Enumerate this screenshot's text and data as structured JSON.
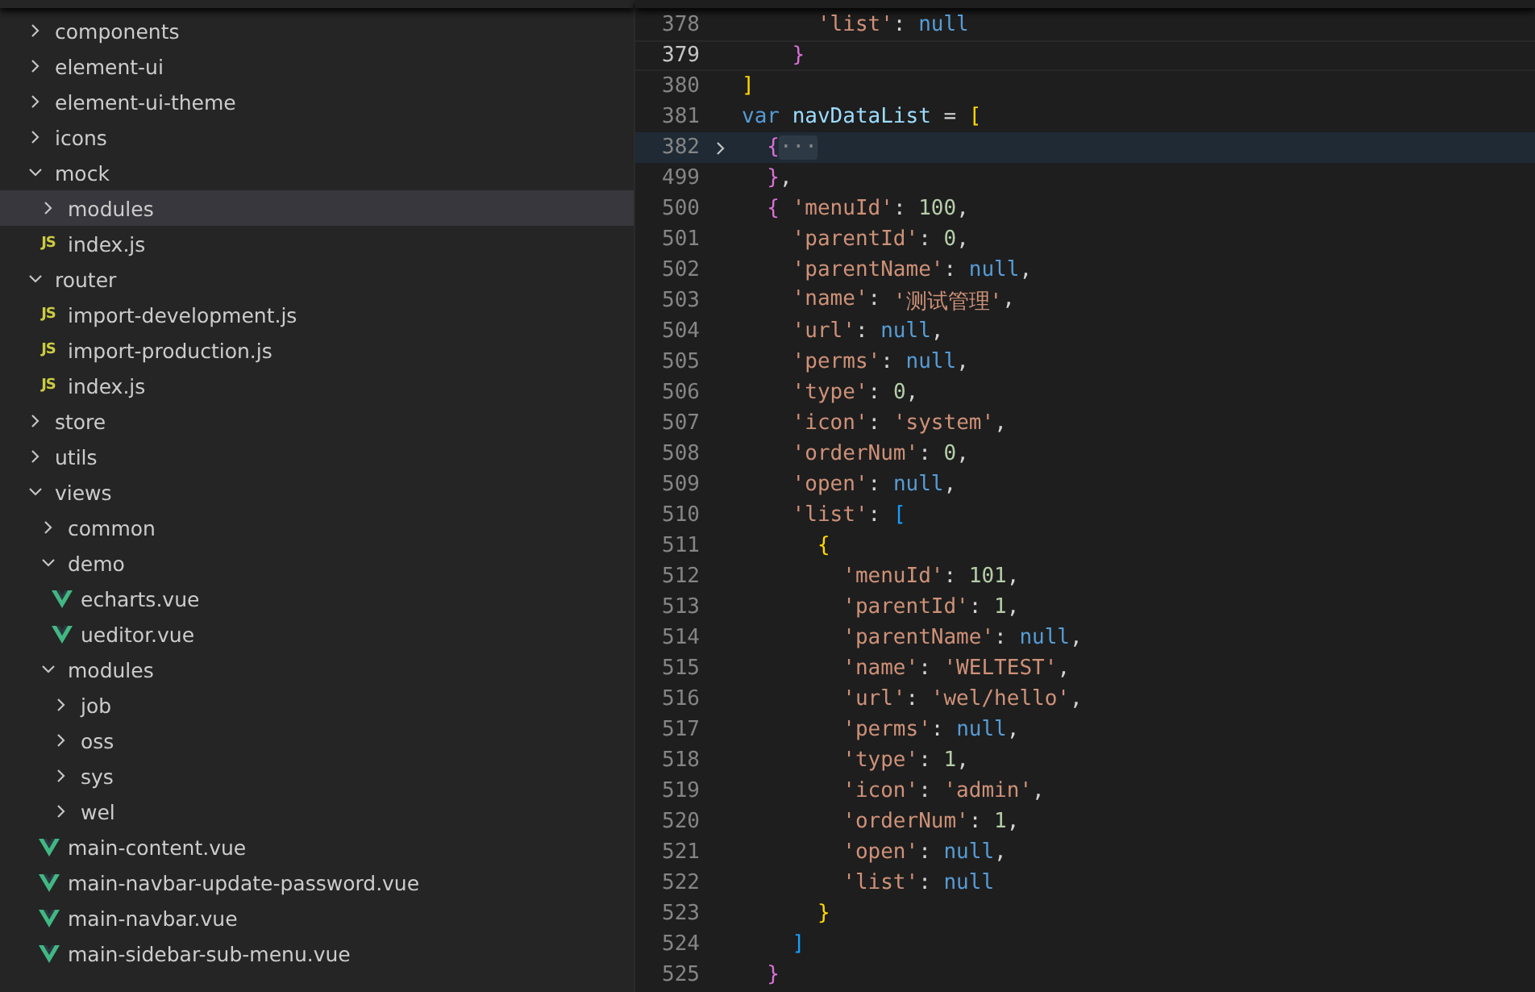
{
  "explorer": {
    "items": [
      {
        "label": "components",
        "kind": "folder",
        "expanded": false,
        "selected": false
      },
      {
        "label": "element-ui",
        "kind": "folder",
        "expanded": false,
        "selected": false
      },
      {
        "label": "element-ui-theme",
        "kind": "folder",
        "expanded": false,
        "selected": false
      },
      {
        "label": "icons",
        "kind": "folder",
        "expanded": false,
        "selected": false
      },
      {
        "label": "mock",
        "kind": "folder",
        "expanded": true,
        "selected": false,
        "children": [
          {
            "label": "modules",
            "kind": "folder",
            "expanded": false,
            "selected": true
          },
          {
            "label": "index.js",
            "kind": "js",
            "icon_text": "JS",
            "selected": false
          }
        ]
      },
      {
        "label": "router",
        "kind": "folder",
        "expanded": true,
        "selected": false,
        "children": [
          {
            "label": "import-development.js",
            "kind": "js",
            "icon_text": "JS",
            "selected": false
          },
          {
            "label": "import-production.js",
            "kind": "js",
            "icon_text": "JS",
            "selected": false
          },
          {
            "label": "index.js",
            "kind": "js",
            "icon_text": "JS",
            "selected": false
          }
        ]
      },
      {
        "label": "store",
        "kind": "folder",
        "expanded": false,
        "selected": false
      },
      {
        "label": "utils",
        "kind": "folder",
        "expanded": false,
        "selected": false
      },
      {
        "label": "views",
        "kind": "folder",
        "expanded": true,
        "selected": false,
        "children": [
          {
            "label": "common",
            "kind": "folder",
            "expanded": false,
            "selected": false
          },
          {
            "label": "demo",
            "kind": "folder",
            "expanded": true,
            "selected": false,
            "children": [
              {
                "label": "echarts.vue",
                "kind": "vue",
                "selected": false
              },
              {
                "label": "ueditor.vue",
                "kind": "vue",
                "selected": false
              }
            ]
          },
          {
            "label": "modules",
            "kind": "folder",
            "expanded": true,
            "selected": false,
            "children": [
              {
                "label": "job",
                "kind": "folder",
                "expanded": false,
                "selected": false
              },
              {
                "label": "oss",
                "kind": "folder",
                "expanded": false,
                "selected": false
              },
              {
                "label": "sys",
                "kind": "folder",
                "expanded": false,
                "selected": false
              },
              {
                "label": "wel",
                "kind": "folder",
                "expanded": false,
                "selected": false
              }
            ]
          },
          {
            "label": "main-content.vue",
            "kind": "vue",
            "selected": false
          },
          {
            "label": "main-navbar-update-password.vue",
            "kind": "vue",
            "selected": false
          },
          {
            "label": "main-navbar.vue",
            "kind": "vue",
            "selected": false
          },
          {
            "label": "main-sidebar-sub-menu.vue",
            "kind": "vue",
            "selected": false
          }
        ]
      }
    ]
  },
  "editor": {
    "lines": [
      {
        "number": "378",
        "current": false,
        "folded": false,
        "tokens": [
          {
            "kind": "key",
            "text": "      'list'"
          },
          {
            "kind": "punct",
            "text": ": "
          },
          {
            "kind": "null",
            "text": "null"
          }
        ]
      },
      {
        "number": "379",
        "current": true,
        "folded": false,
        "tokens": [
          {
            "kind": "b2",
            "text": "    }"
          }
        ]
      },
      {
        "number": "380",
        "current": false,
        "folded": false,
        "tokens": [
          {
            "kind": "b1",
            "text": "]"
          }
        ]
      },
      {
        "number": "381",
        "current": false,
        "folded": false,
        "tokens": [
          {
            "kind": "keyword",
            "text": "var "
          },
          {
            "kind": "var",
            "text": "navDataList"
          },
          {
            "kind": "punct",
            "text": " = "
          },
          {
            "kind": "b1",
            "text": "["
          }
        ]
      },
      {
        "number": "382",
        "current": false,
        "folded": true,
        "tokens": [
          {
            "kind": "b2",
            "text": "  {"
          },
          {
            "kind": "fold",
            "text": "···"
          }
        ]
      },
      {
        "number": "499",
        "current": false,
        "folded": false,
        "tokens": [
          {
            "kind": "b2",
            "text": "  }"
          },
          {
            "kind": "punct",
            "text": ","
          }
        ]
      },
      {
        "number": "500",
        "current": false,
        "folded": false,
        "tokens": [
          {
            "kind": "b2",
            "text": "  { "
          },
          {
            "kind": "key",
            "text": "'menuId'"
          },
          {
            "kind": "punct",
            "text": ": "
          },
          {
            "kind": "num",
            "text": "100"
          },
          {
            "kind": "punct",
            "text": ","
          }
        ]
      },
      {
        "number": "501",
        "current": false,
        "folded": false,
        "tokens": [
          {
            "kind": "key",
            "text": "    'parentId'"
          },
          {
            "kind": "punct",
            "text": ": "
          },
          {
            "kind": "num",
            "text": "0"
          },
          {
            "kind": "punct",
            "text": ","
          }
        ]
      },
      {
        "number": "502",
        "current": false,
        "folded": false,
        "tokens": [
          {
            "kind": "key",
            "text": "    'parentName'"
          },
          {
            "kind": "punct",
            "text": ": "
          },
          {
            "kind": "null",
            "text": "null"
          },
          {
            "kind": "punct",
            "text": ","
          }
        ]
      },
      {
        "number": "503",
        "current": false,
        "folded": false,
        "tokens": [
          {
            "kind": "key",
            "text": "    'name'"
          },
          {
            "kind": "punct",
            "text": ": "
          },
          {
            "kind": "str",
            "text": "'测试管理'"
          },
          {
            "kind": "punct",
            "text": ","
          }
        ]
      },
      {
        "number": "504",
        "current": false,
        "folded": false,
        "tokens": [
          {
            "kind": "key",
            "text": "    'url'"
          },
          {
            "kind": "punct",
            "text": ": "
          },
          {
            "kind": "null",
            "text": "null"
          },
          {
            "kind": "punct",
            "text": ","
          }
        ]
      },
      {
        "number": "505",
        "current": false,
        "folded": false,
        "tokens": [
          {
            "kind": "key",
            "text": "    'perms'"
          },
          {
            "kind": "punct",
            "text": ": "
          },
          {
            "kind": "null",
            "text": "null"
          },
          {
            "kind": "punct",
            "text": ","
          }
        ]
      },
      {
        "number": "506",
        "current": false,
        "folded": false,
        "tokens": [
          {
            "kind": "key",
            "text": "    'type'"
          },
          {
            "kind": "punct",
            "text": ": "
          },
          {
            "kind": "num",
            "text": "0"
          },
          {
            "kind": "punct",
            "text": ","
          }
        ]
      },
      {
        "number": "507",
        "current": false,
        "folded": false,
        "tokens": [
          {
            "kind": "key",
            "text": "    'icon'"
          },
          {
            "kind": "punct",
            "text": ": "
          },
          {
            "kind": "str",
            "text": "'system'"
          },
          {
            "kind": "punct",
            "text": ","
          }
        ]
      },
      {
        "number": "508",
        "current": false,
        "folded": false,
        "tokens": [
          {
            "kind": "key",
            "text": "    'orderNum'"
          },
          {
            "kind": "punct",
            "text": ": "
          },
          {
            "kind": "num",
            "text": "0"
          },
          {
            "kind": "punct",
            "text": ","
          }
        ]
      },
      {
        "number": "509",
        "current": false,
        "folded": false,
        "tokens": [
          {
            "kind": "key",
            "text": "    'open'"
          },
          {
            "kind": "punct",
            "text": ": "
          },
          {
            "kind": "null",
            "text": "null"
          },
          {
            "kind": "punct",
            "text": ","
          }
        ]
      },
      {
        "number": "510",
        "current": false,
        "folded": false,
        "tokens": [
          {
            "kind": "key",
            "text": "    'list'"
          },
          {
            "kind": "punct",
            "text": ": "
          },
          {
            "kind": "b3",
            "text": "["
          }
        ]
      },
      {
        "number": "511",
        "current": false,
        "folded": false,
        "tokens": [
          {
            "kind": "b1",
            "text": "      {"
          }
        ]
      },
      {
        "number": "512",
        "current": false,
        "folded": false,
        "tokens": [
          {
            "kind": "key",
            "text": "        'menuId'"
          },
          {
            "kind": "punct",
            "text": ": "
          },
          {
            "kind": "num",
            "text": "101"
          },
          {
            "kind": "punct",
            "text": ","
          }
        ]
      },
      {
        "number": "513",
        "current": false,
        "folded": false,
        "tokens": [
          {
            "kind": "key",
            "text": "        'parentId'"
          },
          {
            "kind": "punct",
            "text": ": "
          },
          {
            "kind": "num",
            "text": "1"
          },
          {
            "kind": "punct",
            "text": ","
          }
        ]
      },
      {
        "number": "514",
        "current": false,
        "folded": false,
        "tokens": [
          {
            "kind": "key",
            "text": "        'parentName'"
          },
          {
            "kind": "punct",
            "text": ": "
          },
          {
            "kind": "null",
            "text": "null"
          },
          {
            "kind": "punct",
            "text": ","
          }
        ]
      },
      {
        "number": "515",
        "current": false,
        "folded": false,
        "tokens": [
          {
            "kind": "key",
            "text": "        'name'"
          },
          {
            "kind": "punct",
            "text": ": "
          },
          {
            "kind": "str",
            "text": "'WELTEST'"
          },
          {
            "kind": "punct",
            "text": ","
          }
        ]
      },
      {
        "number": "516",
        "current": false,
        "folded": false,
        "tokens": [
          {
            "kind": "key",
            "text": "        'url'"
          },
          {
            "kind": "punct",
            "text": ": "
          },
          {
            "kind": "str",
            "text": "'wel/hello'"
          },
          {
            "kind": "punct",
            "text": ","
          }
        ]
      },
      {
        "number": "517",
        "current": false,
        "folded": false,
        "tokens": [
          {
            "kind": "key",
            "text": "        'perms'"
          },
          {
            "kind": "punct",
            "text": ": "
          },
          {
            "kind": "null",
            "text": "null"
          },
          {
            "kind": "punct",
            "text": ","
          }
        ]
      },
      {
        "number": "518",
        "current": false,
        "folded": false,
        "tokens": [
          {
            "kind": "key",
            "text": "        'type'"
          },
          {
            "kind": "punct",
            "text": ": "
          },
          {
            "kind": "num",
            "text": "1"
          },
          {
            "kind": "punct",
            "text": ","
          }
        ]
      },
      {
        "number": "519",
        "current": false,
        "folded": false,
        "tokens": [
          {
            "kind": "key",
            "text": "        'icon'"
          },
          {
            "kind": "punct",
            "text": ": "
          },
          {
            "kind": "str",
            "text": "'admin'"
          },
          {
            "kind": "punct",
            "text": ","
          }
        ]
      },
      {
        "number": "520",
        "current": false,
        "folded": false,
        "tokens": [
          {
            "kind": "key",
            "text": "        'orderNum'"
          },
          {
            "kind": "punct",
            "text": ": "
          },
          {
            "kind": "num",
            "text": "1"
          },
          {
            "kind": "punct",
            "text": ","
          }
        ]
      },
      {
        "number": "521",
        "current": false,
        "folded": false,
        "tokens": [
          {
            "kind": "key",
            "text": "        'open'"
          },
          {
            "kind": "punct",
            "text": ": "
          },
          {
            "kind": "null",
            "text": "null"
          },
          {
            "kind": "punct",
            "text": ","
          }
        ]
      },
      {
        "number": "522",
        "current": false,
        "folded": false,
        "tokens": [
          {
            "kind": "key",
            "text": "        'list'"
          },
          {
            "kind": "punct",
            "text": ": "
          },
          {
            "kind": "null",
            "text": "null"
          }
        ]
      },
      {
        "number": "523",
        "current": false,
        "folded": false,
        "tokens": [
          {
            "kind": "b1",
            "text": "      }"
          }
        ]
      },
      {
        "number": "524",
        "current": false,
        "folded": false,
        "tokens": [
          {
            "kind": "b3",
            "text": "    ]"
          }
        ]
      },
      {
        "number": "525",
        "current": false,
        "folded": false,
        "tokens": [
          {
            "kind": "b2",
            "text": "  }"
          }
        ]
      }
    ]
  }
}
